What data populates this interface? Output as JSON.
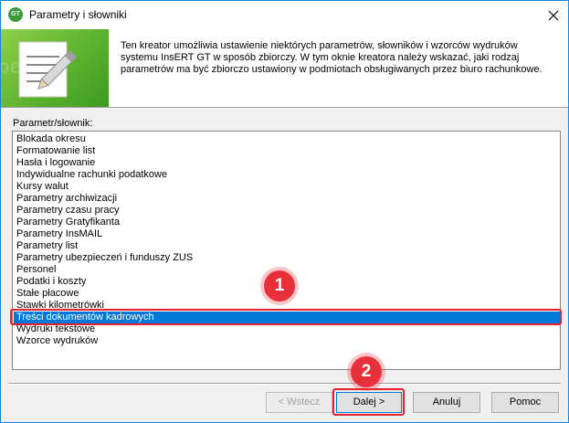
{
  "window": {
    "title": "Parametry i słowniki",
    "app_icon_text": "GT"
  },
  "header": {
    "description": "Ten kreator umożliwia ustawienie niektórych parametrów, słowników i wzorców wydruków systemu InsERT GT w sposób zbiorczy. W tym oknie kreatora należy wskazać, jaki rodzaj parametrów ma być zbiorczo ustawiony w podmiotach obsługiwanych przez biuro rachunkowe."
  },
  "list": {
    "label": "Parametr/słownik:",
    "items": [
      "Blokada okresu",
      "Formatowanie list",
      "Hasła i logowanie",
      "Indywidualne rachunki podatkowe",
      "Kursy walut",
      "Parametry archiwizacji",
      "Parametry czasu pracy",
      "Parametry Gratyfikanta",
      "Parametry InsMAIL",
      "Parametry list",
      "Parametry ubezpieczeń i funduszy ZUS",
      "Personel",
      "Podatki i koszty",
      "Stałe płacowe",
      "Stawki kilometrówki",
      "Treści dokumentów kadrowych",
      "Wydruki tekstowe",
      "Wzorce wydruków"
    ],
    "selected_index": 15
  },
  "annotations": {
    "marker1": "1",
    "marker2": "2",
    "color": "#e8303a"
  },
  "buttons": {
    "back": "< Wstecz",
    "next": "Dalej >",
    "cancel": "Anuluj",
    "help": "Pomoc"
  },
  "colors": {
    "selection": "#0078d7",
    "window_border": "#1883d7",
    "header_green": "#5cb32e"
  }
}
